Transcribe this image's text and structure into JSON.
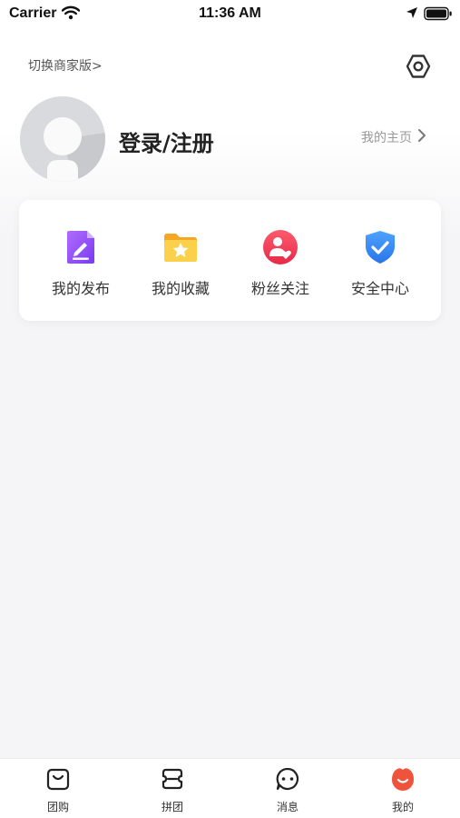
{
  "status_bar": {
    "carrier": "Carrier",
    "time": "11:36 AM"
  },
  "header": {
    "switch_merchant": "切换商家版>",
    "settings_icon": "settings-hexagon-icon"
  },
  "profile": {
    "login_label": "登录/注册",
    "homepage_label": "我的主页"
  },
  "quick_actions": [
    {
      "label": "我的发布",
      "icon": "edit-document-icon",
      "color": "#8a4bf5"
    },
    {
      "label": "我的收藏",
      "icon": "star-folder-icon",
      "color": "#f7b733"
    },
    {
      "label": "粉丝关注",
      "icon": "fans-heart-icon",
      "color": "#ee3a58"
    },
    {
      "label": "安全中心",
      "icon": "shield-check-icon",
      "color": "#2f86f6"
    }
  ],
  "tab_bar": {
    "items": [
      {
        "label": "团购",
        "icon": "shopping-bag-icon"
      },
      {
        "label": "拼团",
        "icon": "group-ticket-icon"
      },
      {
        "label": "消息",
        "icon": "chat-bubble-icon"
      },
      {
        "label": "我的",
        "icon": "profile-face-icon",
        "active_color": "#f0533c"
      }
    ]
  }
}
